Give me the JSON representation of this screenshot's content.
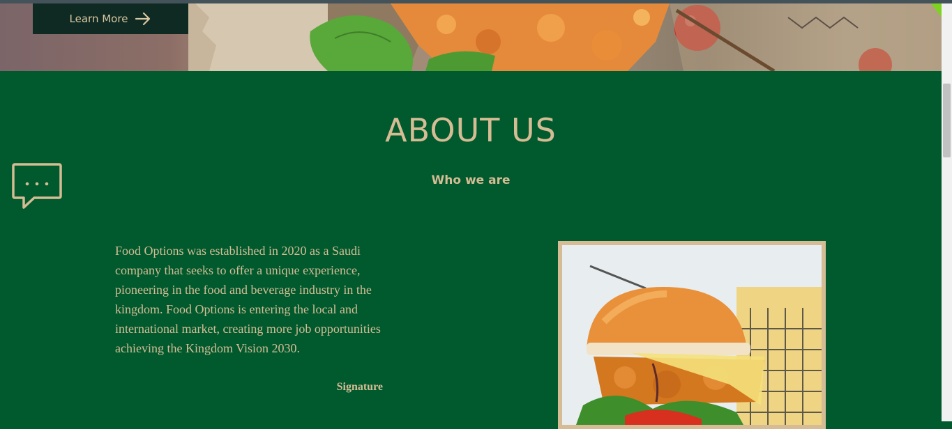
{
  "hero": {
    "button_label": "Learn More",
    "button_icon": "arrow-right-icon"
  },
  "about": {
    "title": "ABOUT US",
    "subtitle": "Who we are",
    "icon": "chat-bubble-icon",
    "paragraph": "Food Options was established in 2020 as a Saudi company that seeks to offer a unique experience, pioneering in the food and beverage industry in the kingdom. Food Options is entering the local and international market, creating more job opportunities achieving the Kingdom Vision 2030.",
    "signature": "Signature",
    "image": "burger-photo"
  },
  "colors": {
    "section_bg": "#005a2e",
    "accent": "#d6bc94",
    "button_bg": "#0f2a22"
  }
}
